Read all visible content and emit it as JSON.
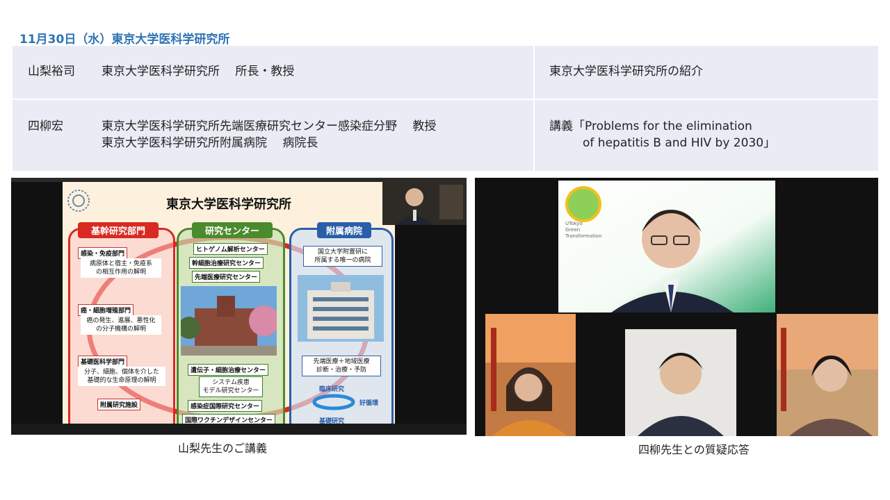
{
  "heading": "11月30日（水）東京大学医科学研究所",
  "rows": [
    {
      "name": "山梨裕司",
      "affiliation": [
        "東京大学医科学研究所　 所長・教授"
      ],
      "topic": [
        "東京大学医科学研究所の紹介"
      ]
    },
    {
      "name": "四柳宏",
      "affiliation": [
        "東京大学医科学研究所先端医療研究センター感染症分野　 教授",
        "東京大学医科学研究所附属病院　 病院長"
      ],
      "topic": [
        "講義「Problems for the elimination",
        "of hepatitis B and HIV by 2030」"
      ]
    }
  ],
  "captions": {
    "left": "山梨先生のご講義",
    "right": "四柳先生との質疑応答"
  },
  "slide": {
    "title": "東京大学医科学研究所",
    "col1": {
      "header": "基幹研究部門",
      "items": [
        {
          "label": "感染・免疫部門",
          "desc": [
            "病原体と宿主・免疫系",
            "の相互作用の解明"
          ]
        },
        {
          "label": "癌・細胞増殖部門",
          "desc": [
            "癌の発生、進展、悪性化",
            "の分子機構の解明"
          ]
        },
        {
          "label": "基礎医科学部門",
          "desc": [
            "分子、細胞、個体を介した",
            "基礎的な生命原理の解明"
          ]
        }
      ],
      "footer": "附属研究施設"
    },
    "col2": {
      "header": "研究センター",
      "top": [
        "ヒトゲノム解析センター",
        "幹細胞治療研究センター",
        "先端医療研究センター"
      ],
      "bottom": [
        "遺伝子・細胞治療センター",
        "システム疾患\nモデル研究センター",
        "感染症国際研究センター",
        "国際ワクチンデザインセンター"
      ]
    },
    "col3": {
      "header": "附属病院",
      "top": "国立大学附置研に\n所属する唯一の病院",
      "middle": "先端医療＋地域医療\n診断・治療・予防",
      "cycle": [
        "臨床研究",
        "好循環",
        "基礎研究"
      ]
    }
  },
  "virtual_bg": {
    "logo_text": [
      "UTokyo",
      "Green",
      "Transformation"
    ]
  },
  "colors": {
    "heading": "#2e74b5",
    "table_bg": "#e9ecf4"
  }
}
